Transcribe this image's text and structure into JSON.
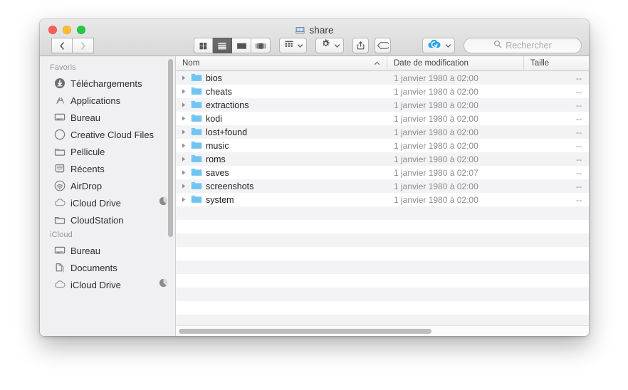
{
  "window": {
    "title": "share",
    "title_icon": "network-drive-icon",
    "traffic_lights": [
      {
        "name": "close-button",
        "color": "#ff5f57"
      },
      {
        "name": "minimize-button",
        "color": "#ffbd2e"
      },
      {
        "name": "maximize-button",
        "color": "#28c940"
      }
    ]
  },
  "toolbar": {
    "back_label": "chevron-left-icon",
    "forward_label": "chevron-right-icon",
    "view_modes": [
      {
        "name": "icon-view",
        "icon": "grid-icon",
        "active": false
      },
      {
        "name": "list-view",
        "icon": "list-icon",
        "active": true
      },
      {
        "name": "column-view",
        "icon": "columns-icon",
        "active": false
      },
      {
        "name": "gallery-view",
        "icon": "coverflow-icon",
        "active": false
      }
    ],
    "arrange_icon": "arrange-grid-icon",
    "action_icon": "gear-icon",
    "share_icon": "share-icon",
    "tag_icon": "tag-icon",
    "cloud_icon": "cloud-sync-icon"
  },
  "search": {
    "placeholder": "Rechercher",
    "value": "",
    "icon": "search-icon"
  },
  "sidebar": {
    "groups": [
      {
        "title": "Favoris",
        "items": [
          {
            "label": "Téléchargements",
            "icon": "downloads-icon",
            "badge": ""
          },
          {
            "label": "Applications",
            "icon": "applications-icon",
            "badge": ""
          },
          {
            "label": "Bureau",
            "icon": "desktop-icon",
            "badge": ""
          },
          {
            "label": "Creative Cloud Files",
            "icon": "creative-cloud-icon",
            "badge": ""
          },
          {
            "label": "Pellicule",
            "icon": "folder-icon",
            "badge": ""
          },
          {
            "label": "Récents",
            "icon": "recents-icon",
            "badge": ""
          },
          {
            "label": "AirDrop",
            "icon": "airdrop-icon",
            "badge": ""
          },
          {
            "label": "iCloud Drive",
            "icon": "cloud-icon",
            "badge": "progress-pie"
          },
          {
            "label": "CloudStation",
            "icon": "folder-icon",
            "badge": ""
          }
        ]
      },
      {
        "title": "iCloud",
        "items": [
          {
            "label": "Bureau",
            "icon": "desktop-icon",
            "badge": ""
          },
          {
            "label": "Documents",
            "icon": "documents-icon",
            "badge": ""
          },
          {
            "label": "iCloud Drive",
            "icon": "cloud-icon",
            "badge": "progress-pie"
          }
        ]
      }
    ]
  },
  "filelist": {
    "columns": [
      {
        "key": "name",
        "label": "Nom",
        "sorted": "asc"
      },
      {
        "key": "date",
        "label": "Date de modification",
        "sorted": ""
      },
      {
        "key": "size",
        "label": "Taille",
        "sorted": ""
      }
    ],
    "rows": [
      {
        "name": "bios",
        "date": "1 janvier 1980 à 02:00",
        "size": "--",
        "kind": "folder"
      },
      {
        "name": "cheats",
        "date": "1 janvier 1980 à 02:00",
        "size": "--",
        "kind": "folder"
      },
      {
        "name": "extractions",
        "date": "1 janvier 1980 à 02:00",
        "size": "--",
        "kind": "folder"
      },
      {
        "name": "kodi",
        "date": "1 janvier 1980 à 02:00",
        "size": "--",
        "kind": "folder"
      },
      {
        "name": "lost+found",
        "date": "1 janvier 1980 à 02:00",
        "size": "--",
        "kind": "folder"
      },
      {
        "name": "music",
        "date": "1 janvier 1980 à 02:00",
        "size": "--",
        "kind": "folder"
      },
      {
        "name": "roms",
        "date": "1 janvier 1980 à 02:00",
        "size": "--",
        "kind": "folder"
      },
      {
        "name": "saves",
        "date": "1 janvier 1980 à 02:07",
        "size": "--",
        "kind": "folder"
      },
      {
        "name": "screenshots",
        "date": "1 janvier 1980 à 02:00",
        "size": "--",
        "kind": "folder"
      },
      {
        "name": "system",
        "date": "1 janvier 1980 à 02:00",
        "size": "--",
        "kind": "folder"
      }
    ],
    "empty_row_count": 9
  },
  "colors": {
    "folder_blue": "#6fc4f2",
    "accent_blue": "#2196f3",
    "sidebar_bg": "#f0eff1",
    "stripe": "#f3f3f5",
    "window_chrome": "#e4e4e4"
  }
}
